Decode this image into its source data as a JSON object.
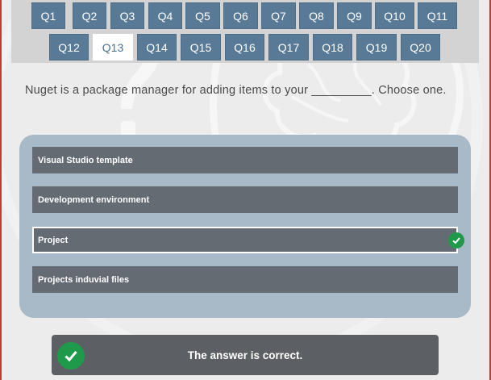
{
  "nav": {
    "questions": [
      "Q1",
      "Q2",
      "Q3",
      "Q4",
      "Q5",
      "Q6",
      "Q7",
      "Q8",
      "Q9",
      "Q10",
      "Q11",
      "Q12",
      "Q13",
      "Q14",
      "Q15",
      "Q16",
      "Q17",
      "Q18",
      "Q19",
      "Q20"
    ],
    "current": "Q13"
  },
  "question": {
    "text": "Nuget is a package manager for adding items to your _________. Choose one."
  },
  "answers": [
    {
      "label": "Visual Studio template",
      "selected": false
    },
    {
      "label": "Development environment",
      "selected": false
    },
    {
      "label": "Project",
      "selected": true
    },
    {
      "label": "Projects induvial files",
      "selected": false
    }
  ],
  "feedback": {
    "message": "The answer is correct.",
    "status": "correct"
  },
  "colors": {
    "nav_button": "#587a96",
    "answer_bg": "#646b72",
    "panel_bg": "#a8b9c8",
    "correct": "#1f9a4a"
  },
  "icons": {
    "background": "brain-question-icon",
    "correct": "check-circle-icon"
  }
}
